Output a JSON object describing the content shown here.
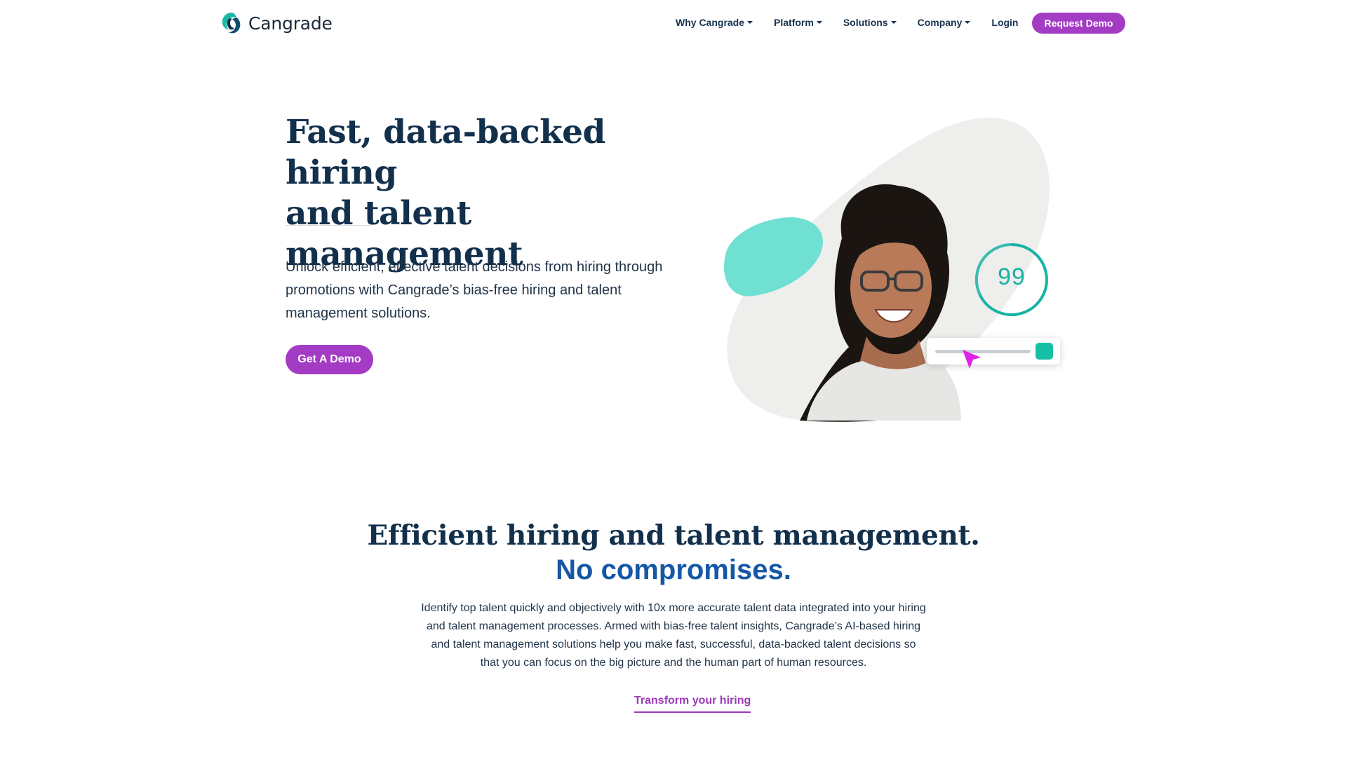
{
  "brand": {
    "name": "Cangrade",
    "colors": {
      "primary_purple": "#a43bc4",
      "navy": "#12304c",
      "blue_accent": "#1558a6",
      "teal": "#16c0a6"
    }
  },
  "nav": {
    "items": [
      {
        "label": "Why Cangrade",
        "has_dropdown": true
      },
      {
        "label": "Platform",
        "has_dropdown": true
      },
      {
        "label": "Solutions",
        "has_dropdown": true
      },
      {
        "label": "Company",
        "has_dropdown": true
      }
    ],
    "login": "Login",
    "request_demo": "Request Demo"
  },
  "hero": {
    "title_line1": "Fast, data-backed hiring",
    "title_line2": "and talent management",
    "body": "Unlock efficient, effective talent decisions from hiring through promotions with Cangrade’s bias-free hiring and talent management solutions.",
    "cta": "Get A Demo",
    "illustration": {
      "score": "99",
      "icons": [
        "score-ring",
        "slider-card",
        "pointer-cursor-icon"
      ]
    }
  },
  "section": {
    "title": "Efficient hiring and talent management.",
    "subtitle": "No compromises.",
    "body": "Identify top talent quickly and objectively with 10x more accurate talent data integrated into your hiring and talent management processes. Armed with bias-free talent insights, Cangrade’s AI-based hiring and talent management solutions help you make fast, successful, data-backed talent decisions so that you can focus on the big picture and the human part of human resources.",
    "link": "Transform your hiring"
  }
}
